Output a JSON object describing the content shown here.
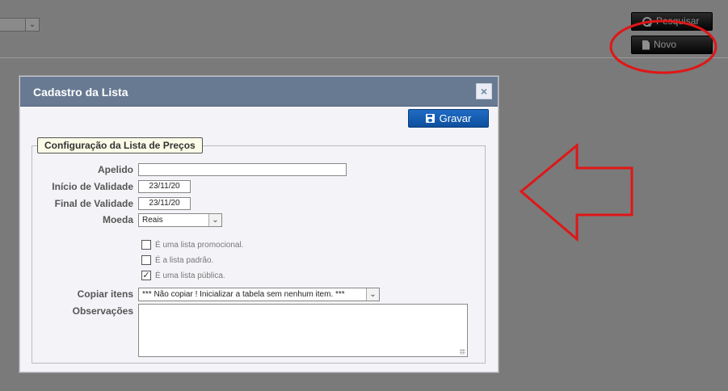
{
  "background": {
    "search_button_label": "Pesquisar",
    "new_button_label": "Novo"
  },
  "dialog": {
    "title": "Cadastro da Lista",
    "close_label": "×",
    "save_button_label": "Gravar",
    "section_legend": "Configuração da Lista de Preços",
    "fields": {
      "apelido": {
        "label": "Apelido",
        "value": ""
      },
      "inicio_validade": {
        "label": "Início de Validade",
        "value": "23/11/20"
      },
      "final_validade": {
        "label": "Final de Validade",
        "value": "23/11/20"
      },
      "moeda": {
        "label": "Moeda",
        "value": "Reais"
      },
      "copiar_itens": {
        "label": "Copiar itens",
        "value": "*** Não copiar ! Inicializar a tabela sem nenhum item. ***"
      },
      "observacoes": {
        "label": "Observações",
        "value": ""
      }
    },
    "checkboxes": [
      {
        "label": "É uma lista promocional.",
        "checked": false
      },
      {
        "label": "É a lista padrão.",
        "checked": false
      },
      {
        "label": "É uma lista pública.",
        "checked": true,
        "mark": "✓"
      }
    ]
  },
  "annotation_colors": {
    "circle": "#e01616",
    "arrow": "#e01616"
  }
}
